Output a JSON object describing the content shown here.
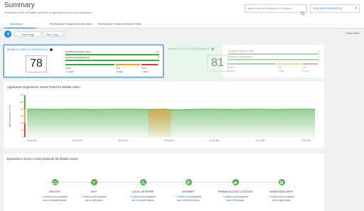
{
  "header": {
    "title": "Summary",
    "subtitle": "Proactively monitor the digital experience for applications across your organization",
    "search_placeholder": "Search Any User/Site/App or PA Location",
    "tenant": "ARCHIVE00731800967917"
  },
  "tabs": [
    {
      "label": "Experience",
      "active": true
    },
    {
      "label": "Performance Trends for Mobile Users",
      "active": false
    },
    {
      "label": "Performance Trends for Remote Sites",
      "active": false
    }
  ],
  "filters": {
    "time_range_label": "Time Range",
    "time_range_value": "Past 7 days",
    "reset_label": "Reset Filters"
  },
  "mobile_users": {
    "heading": "MOBILE USER EXPERIENCE",
    "score": "78",
    "monitored_users_label": "Monitored Mobile Users",
    "monitored_users_value": "27",
    "monitored_users_fraction": 1.0,
    "monitored_apps_label": "Monitored Applications",
    "monitored_apps_value": "8",
    "monitored_apps_fraction": 1.0,
    "segments": [
      {
        "label": "Good",
        "count": "17 Apps",
        "color": "#3aa83a",
        "share": 0.54
      },
      {
        "label": "Fair",
        "count": "3 Apps",
        "color": "#f39a2b",
        "share": 0.27
      },
      {
        "label": "Poor",
        "count": "7 Apps",
        "color": "#d9343a",
        "share": 0.19
      }
    ]
  },
  "remote_sites": {
    "heading": "REMOTE SITE EXPERIENCE",
    "score": "81",
    "monitored_sites_label": "Monitored Remote Sites",
    "monitored_sites_value": "4",
    "monitored_sites_fraction": 1.0,
    "monitored_apps_label": "Monitored Applications",
    "monitored_apps_value": "4",
    "monitored_apps_fraction": 1.0,
    "segments": [
      {
        "label": "Good",
        "count": "3 Apps",
        "color": "#3aa83a",
        "share": 0.54
      },
      {
        "label": "Fair",
        "count": "1 Apps",
        "color": "#f39a2b",
        "share": 0.27
      },
      {
        "label": "Poor",
        "count": "0 Apps",
        "color": "#d9343a",
        "share": 0.19
      }
    ]
  },
  "chart_data": {
    "type": "area",
    "title": "Application Experience Score Trend for Mobile Users",
    "ylabel": "App Experience Score",
    "xlabel": "",
    "ylim": [
      0,
      120
    ],
    "yticks": [
      0,
      20,
      40,
      60,
      80,
      100,
      120
    ],
    "xtick_labels": [
      "06:00 AM",
      "07:00 AM",
      "08:00 AM",
      "09:00 AM",
      "10:00 AM",
      "11:00 AM",
      "12:00 PM"
    ],
    "x": [
      5.9,
      6.2,
      6.5,
      6.8,
      7.1,
      7.4,
      7.7,
      8.0,
      8.3,
      8.6,
      8.9,
      9.0,
      9.2,
      9.5,
      9.8,
      10.1,
      10.4,
      10.7,
      11.0,
      11.3,
      11.6,
      11.9,
      12.2
    ],
    "y": [
      80,
      80,
      79,
      80,
      80,
      79,
      80,
      80,
      80,
      79,
      80,
      79,
      78,
      79,
      80,
      80,
      79,
      80,
      80,
      79,
      80,
      80,
      80
    ],
    "highlight_range": [
      8.55,
      9.05
    ],
    "band_colors": {
      "good": "#3aa83a",
      "fair": "#f39a2b",
      "poor": "#d9343a"
    }
  },
  "network": {
    "title": "Experience Score Across Network for Mobile Users",
    "items": [
      {
        "name": "DEVICES",
        "icon": "devices-icon",
        "count": "2 mobile users",
        "suffix": " impacted",
        "detail": "due to endpoint issues"
      },
      {
        "name": "WI-FI",
        "icon": "wifi-icon",
        "count": "0 mobile users",
        "suffix": " impacted",
        "detail": "due to wifi issues"
      },
      {
        "name": "LOCAL NETWORK",
        "icon": "network-icon",
        "count": "4 mobile users",
        "suffix": " impacted",
        "detail": "due to modem issues"
      },
      {
        "name": "INTERNET",
        "icon": "globe-icon",
        "count": "2 mobile users",
        "suffix": " impacted",
        "detail": "due to Internet issues"
      },
      {
        "name": "PRISMA ACCESS LOCATION",
        "icon": "cloud-icon",
        "count": "2 mobile users",
        "suffix": " impacted",
        "detail": "due to PA issues"
      },
      {
        "name": "MONITORED APPS",
        "icon": "apps-icon",
        "count": "2 mobile users",
        "suffix": " impacted",
        "detail": "due to app issues"
      }
    ]
  }
}
